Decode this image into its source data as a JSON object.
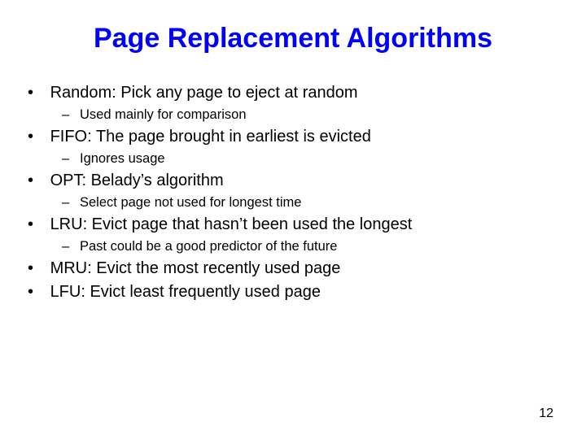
{
  "title": "Page Replacement Algorithms",
  "bullets": [
    {
      "text": "Random: Pick any page to eject at random",
      "subs": [
        "Used mainly for comparison"
      ]
    },
    {
      "text": "FIFO: The page brought in earliest is evicted",
      "subs": [
        "Ignores usage"
      ]
    },
    {
      "text": "OPT: Belady’s algorithm",
      "subs": [
        "Select page not used for longest time"
      ]
    },
    {
      "text": "LRU: Evict page that hasn’t been used the longest",
      "subs": [
        "Past could be a good predictor of the future"
      ]
    },
    {
      "text": "MRU: Evict the most recently used page",
      "subs": []
    },
    {
      "text": "LFU: Evict least frequently used page",
      "subs": []
    }
  ],
  "page_number": "12"
}
